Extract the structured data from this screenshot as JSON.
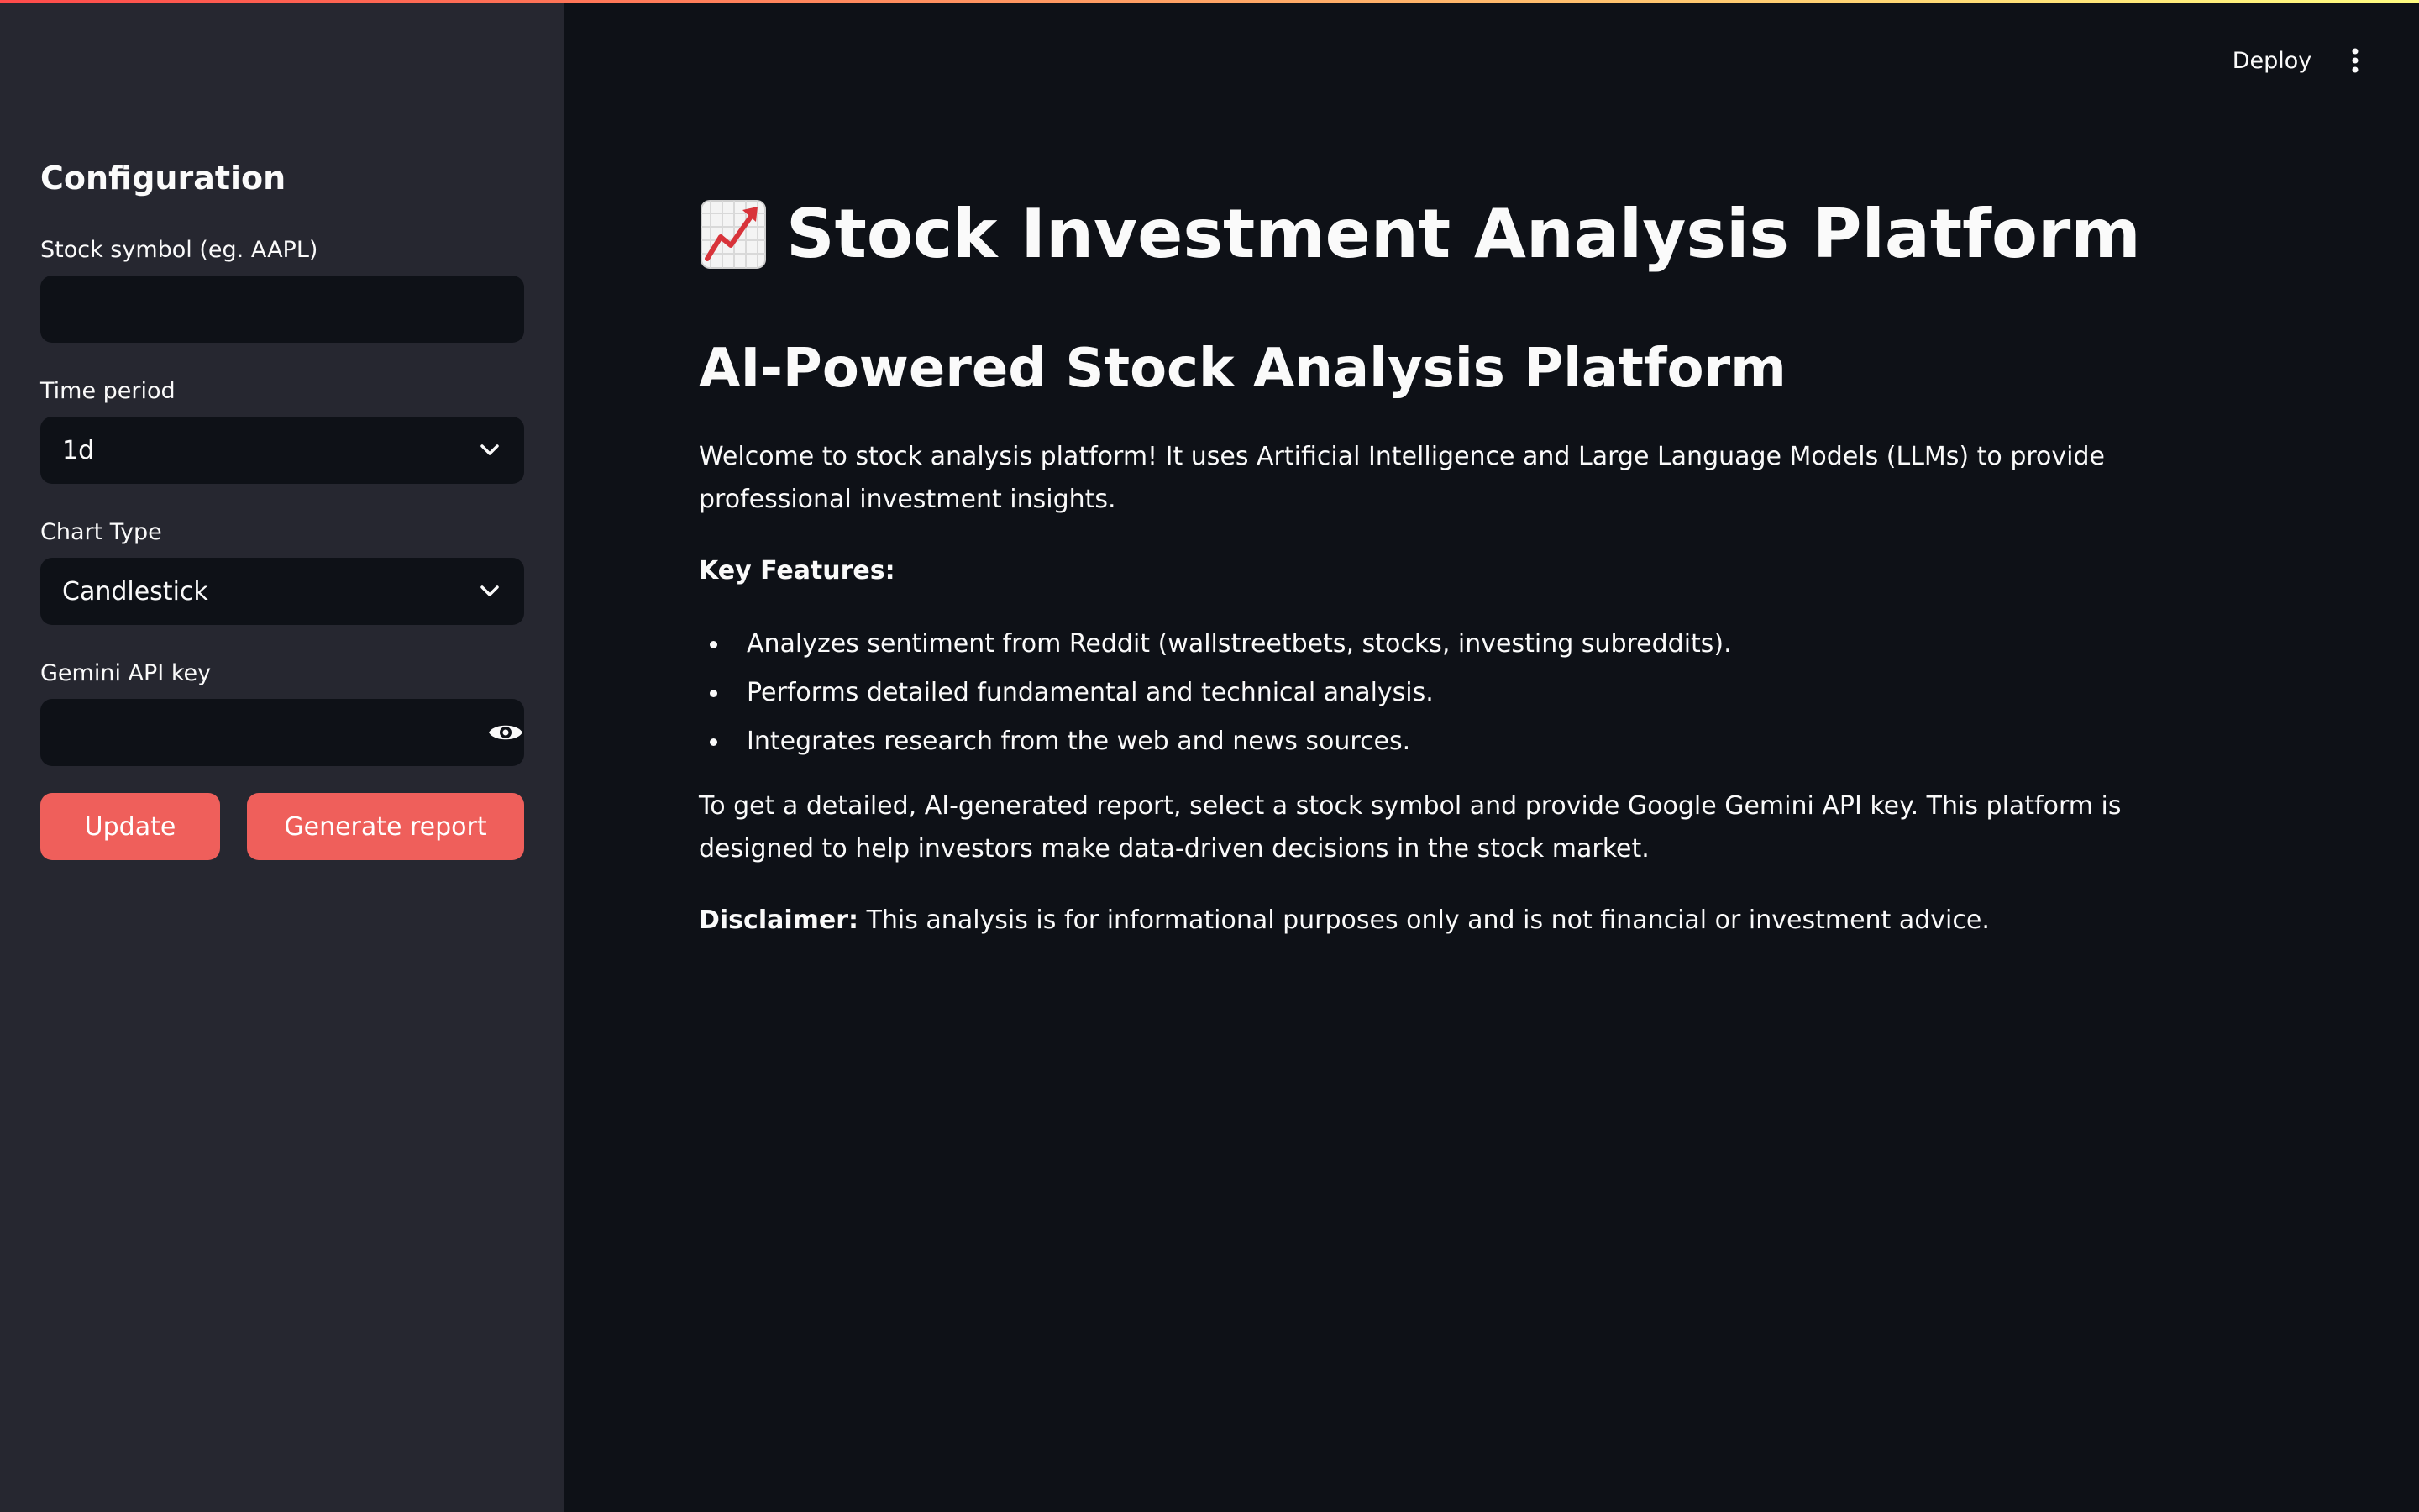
{
  "sidebar": {
    "title": "Configuration",
    "stock_symbol": {
      "label": "Stock symbol (eg. AAPL)",
      "value": ""
    },
    "time_period": {
      "label": "Time period",
      "value": "1d"
    },
    "chart_type": {
      "label": "Chart Type",
      "value": "Candlestick"
    },
    "api_key": {
      "label": "Gemini API key",
      "value": ""
    },
    "update_label": "Update",
    "generate_label": "Generate report"
  },
  "header": {
    "deploy_label": "Deploy"
  },
  "main": {
    "title": "Stock Investment Analysis Platform",
    "subtitle": "AI-Powered Stock Analysis Platform",
    "welcome": "Welcome to stock analysis platform! It uses Artificial Intelligence and Large Language Models (LLMs) to provide professional investment insights.",
    "features_heading": "Key Features:",
    "features": [
      "Analyzes sentiment from Reddit (wallstreetbets, stocks, investing subreddits).",
      "Performs detailed fundamental and technical analysis.",
      "Integrates research from the web and news sources."
    ],
    "report_info": "To get a detailed, AI-generated report, select a stock symbol and provide Google Gemini API key. This platform is designed to help investors make data-driven decisions in the stock market.",
    "disclaimer_label": "Disclaimer:",
    "disclaimer_text": " This analysis is for informational purposes only and is not financial or investment advice."
  },
  "colors": {
    "background": "#0e1117",
    "sidebar": "#262730",
    "accent": "#ef5f5b",
    "text": "#fafafa"
  },
  "icons": {
    "title": "chart-increasing-icon",
    "password_toggle": "eye-icon",
    "select": "chevron-down-icon",
    "menu": "vertical-ellipsis-icon"
  }
}
